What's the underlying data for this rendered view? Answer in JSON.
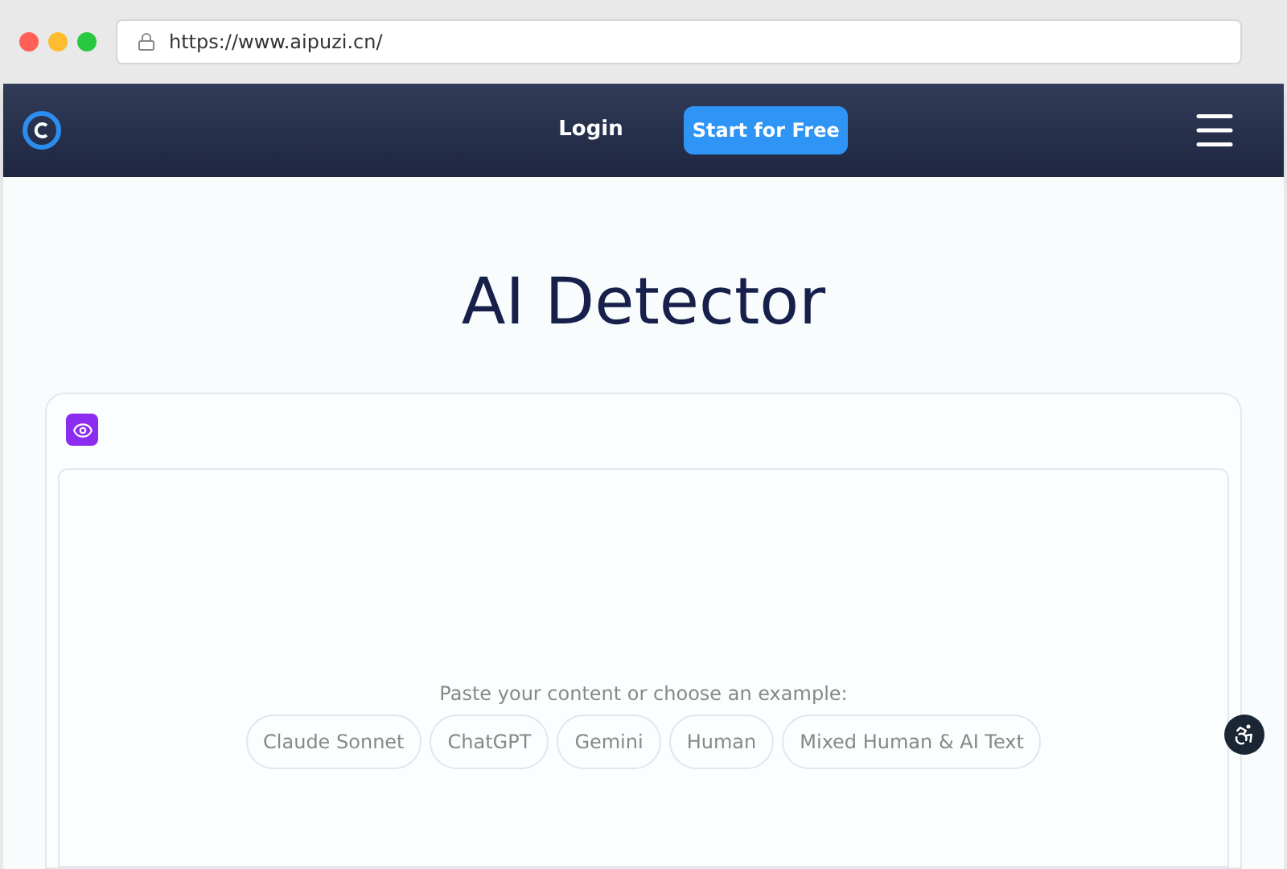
{
  "browser": {
    "url": "https://www.aipuzi.cn/"
  },
  "nav": {
    "login": "Login",
    "cta": "Start for Free"
  },
  "title": "AI Detector",
  "editor": {
    "prompt": "Paste your content or choose an example:",
    "examples": [
      "Claude Sonnet",
      "ChatGPT",
      "Gemini",
      "Human",
      "Mixed Human & AI Text"
    ]
  }
}
